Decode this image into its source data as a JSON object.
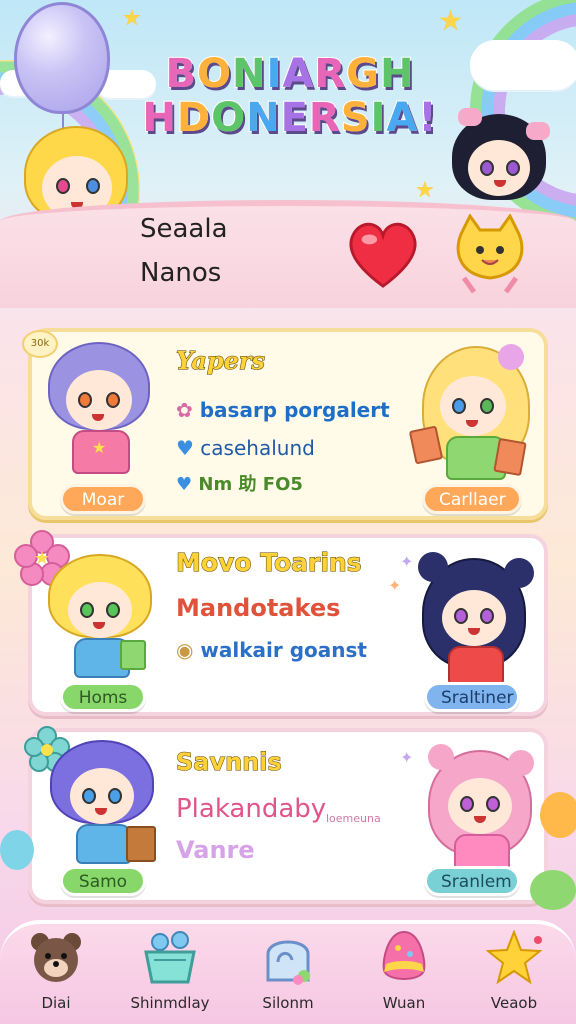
{
  "header": {
    "logo_line1": "BONIARGH",
    "logo_line2": "HDONERSIA!"
  },
  "hero": {
    "line1": "Seaala",
    "line2": "Nanos"
  },
  "cards": [
    {
      "corner_tag": "30k",
      "title": "Yapers",
      "line1": "basarp porgalert",
      "line2": "casehalund",
      "line3": "Nm 助 FO5",
      "left_badge": "Moar",
      "right_badge": "Carllaer"
    },
    {
      "title": "Movo Toarins",
      "line1": "Mandotakes",
      "line2": "walkair goanst",
      "left_badge": "Homs",
      "right_badge": "Sraltiner"
    },
    {
      "title": "Savnnis",
      "line1": "Plakandaby",
      "line1_small": "loemeuna",
      "line2": "Vanre",
      "left_badge": "Samo",
      "right_badge": "Sranlem"
    }
  ],
  "nav": [
    {
      "label": "Diai",
      "icon": "bear-icon"
    },
    {
      "label": "Shinmdlay",
      "icon": "basket-icon"
    },
    {
      "label": "Silonm",
      "icon": "mirror-icon"
    },
    {
      "label": "Wuan",
      "icon": "egg-icon"
    },
    {
      "label": "Veaob",
      "icon": "star-icon"
    }
  ],
  "colors": {
    "accent_pink": "#e866b8",
    "accent_orange": "#ffa85a",
    "accent_green": "#87d76a",
    "accent_blue": "#7fb4ef"
  }
}
